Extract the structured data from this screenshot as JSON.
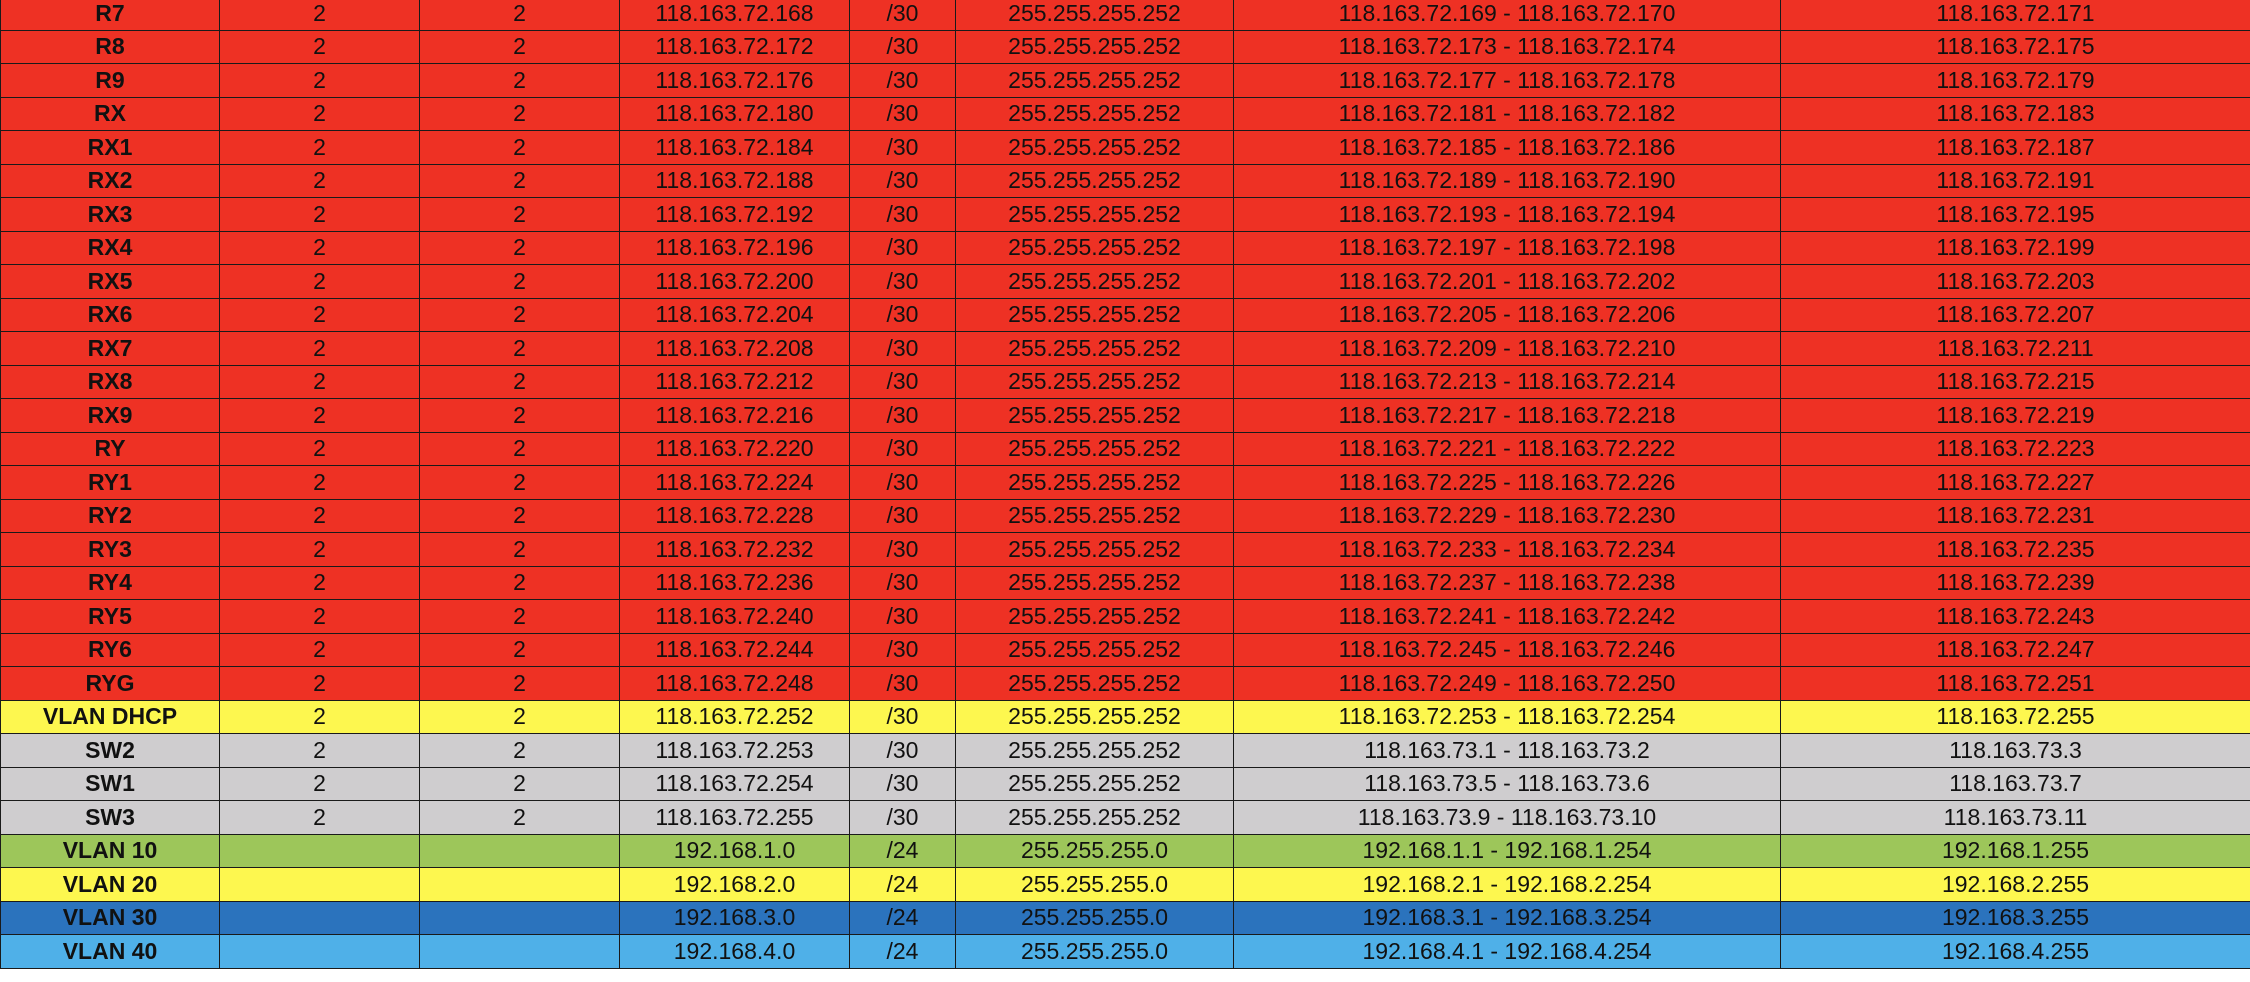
{
  "colors": {
    "red": "#ee3124",
    "yellow": "#fdf74f",
    "gray": "#cfcdcf",
    "green": "#9dc65a",
    "blue": "#2b73bd",
    "lightblue": "#4fb0e8"
  },
  "rows": [
    {
      "name": "R7",
      "a": "2",
      "b": "2",
      "network": "118.163.72.168",
      "cidr": "/30",
      "mask": "255.255.255.252",
      "range": "118.163.72.169 - 118.163.72.170",
      "broadcast": "118.163.72.171",
      "color": "red"
    },
    {
      "name": "R8",
      "a": "2",
      "b": "2",
      "network": "118.163.72.172",
      "cidr": "/30",
      "mask": "255.255.255.252",
      "range": "118.163.72.173 - 118.163.72.174",
      "broadcast": "118.163.72.175",
      "color": "red"
    },
    {
      "name": "R9",
      "a": "2",
      "b": "2",
      "network": "118.163.72.176",
      "cidr": "/30",
      "mask": "255.255.255.252",
      "range": "118.163.72.177 - 118.163.72.178",
      "broadcast": "118.163.72.179",
      "color": "red"
    },
    {
      "name": "RX",
      "a": "2",
      "b": "2",
      "network": "118.163.72.180",
      "cidr": "/30",
      "mask": "255.255.255.252",
      "range": "118.163.72.181 - 118.163.72.182",
      "broadcast": "118.163.72.183",
      "color": "red"
    },
    {
      "name": "RX1",
      "a": "2",
      "b": "2",
      "network": "118.163.72.184",
      "cidr": "/30",
      "mask": "255.255.255.252",
      "range": "118.163.72.185 - 118.163.72.186",
      "broadcast": "118.163.72.187",
      "color": "red"
    },
    {
      "name": "RX2",
      "a": "2",
      "b": "2",
      "network": "118.163.72.188",
      "cidr": "/30",
      "mask": "255.255.255.252",
      "range": "118.163.72.189 - 118.163.72.190",
      "broadcast": "118.163.72.191",
      "color": "red"
    },
    {
      "name": "RX3",
      "a": "2",
      "b": "2",
      "network": "118.163.72.192",
      "cidr": "/30",
      "mask": "255.255.255.252",
      "range": "118.163.72.193 - 118.163.72.194",
      "broadcast": "118.163.72.195",
      "color": "red"
    },
    {
      "name": "RX4",
      "a": "2",
      "b": "2",
      "network": "118.163.72.196",
      "cidr": "/30",
      "mask": "255.255.255.252",
      "range": "118.163.72.197 - 118.163.72.198",
      "broadcast": "118.163.72.199",
      "color": "red"
    },
    {
      "name": "RX5",
      "a": "2",
      "b": "2",
      "network": "118.163.72.200",
      "cidr": "/30",
      "mask": "255.255.255.252",
      "range": "118.163.72.201 - 118.163.72.202",
      "broadcast": "118.163.72.203",
      "color": "red"
    },
    {
      "name": "RX6",
      "a": "2",
      "b": "2",
      "network": "118.163.72.204",
      "cidr": "/30",
      "mask": "255.255.255.252",
      "range": "118.163.72.205 - 118.163.72.206",
      "broadcast": "118.163.72.207",
      "color": "red"
    },
    {
      "name": "RX7",
      "a": "2",
      "b": "2",
      "network": "118.163.72.208",
      "cidr": "/30",
      "mask": "255.255.255.252",
      "range": "118.163.72.209 - 118.163.72.210",
      "broadcast": "118.163.72.211",
      "color": "red"
    },
    {
      "name": "RX8",
      "a": "2",
      "b": "2",
      "network": "118.163.72.212",
      "cidr": "/30",
      "mask": "255.255.255.252",
      "range": "118.163.72.213 - 118.163.72.214",
      "broadcast": "118.163.72.215",
      "color": "red"
    },
    {
      "name": "RX9",
      "a": "2",
      "b": "2",
      "network": "118.163.72.216",
      "cidr": "/30",
      "mask": "255.255.255.252",
      "range": "118.163.72.217 - 118.163.72.218",
      "broadcast": "118.163.72.219",
      "color": "red"
    },
    {
      "name": "RY",
      "a": "2",
      "b": "2",
      "network": "118.163.72.220",
      "cidr": "/30",
      "mask": "255.255.255.252",
      "range": "118.163.72.221 - 118.163.72.222",
      "broadcast": "118.163.72.223",
      "color": "red"
    },
    {
      "name": "RY1",
      "a": "2",
      "b": "2",
      "network": "118.163.72.224",
      "cidr": "/30",
      "mask": "255.255.255.252",
      "range": "118.163.72.225 - 118.163.72.226",
      "broadcast": "118.163.72.227",
      "color": "red"
    },
    {
      "name": "RY2",
      "a": "2",
      "b": "2",
      "network": "118.163.72.228",
      "cidr": "/30",
      "mask": "255.255.255.252",
      "range": "118.163.72.229 - 118.163.72.230",
      "broadcast": "118.163.72.231",
      "color": "red"
    },
    {
      "name": "RY3",
      "a": "2",
      "b": "2",
      "network": "118.163.72.232",
      "cidr": "/30",
      "mask": "255.255.255.252",
      "range": "118.163.72.233 - 118.163.72.234",
      "broadcast": "118.163.72.235",
      "color": "red"
    },
    {
      "name": "RY4",
      "a": "2",
      "b": "2",
      "network": "118.163.72.236",
      "cidr": "/30",
      "mask": "255.255.255.252",
      "range": "118.163.72.237 - 118.163.72.238",
      "broadcast": "118.163.72.239",
      "color": "red"
    },
    {
      "name": "RY5",
      "a": "2",
      "b": "2",
      "network": "118.163.72.240",
      "cidr": "/30",
      "mask": "255.255.255.252",
      "range": "118.163.72.241 - 118.163.72.242",
      "broadcast": "118.163.72.243",
      "color": "red"
    },
    {
      "name": "RY6",
      "a": "2",
      "b": "2",
      "network": "118.163.72.244",
      "cidr": "/30",
      "mask": "255.255.255.252",
      "range": "118.163.72.245 - 118.163.72.246",
      "broadcast": "118.163.72.247",
      "color": "red"
    },
    {
      "name": "RYG",
      "a": "2",
      "b": "2",
      "network": "118.163.72.248",
      "cidr": "/30",
      "mask": "255.255.255.252",
      "range": "118.163.72.249 - 118.163.72.250",
      "broadcast": "118.163.72.251",
      "color": "red"
    },
    {
      "name": "VLAN DHCP",
      "a": "2",
      "b": "2",
      "network": "118.163.72.252",
      "cidr": "/30",
      "mask": "255.255.255.252",
      "range": "118.163.72.253 - 118.163.72.254",
      "broadcast": "118.163.72.255",
      "color": "yellow"
    },
    {
      "name": "SW2",
      "a": "2",
      "b": "2",
      "network": "118.163.72.253",
      "cidr": "/30",
      "mask": "255.255.255.252",
      "range": "118.163.73.1 - 118.163.73.2",
      "broadcast": "118.163.73.3",
      "color": "gray"
    },
    {
      "name": "SW1",
      "a": "2",
      "b": "2",
      "network": "118.163.72.254",
      "cidr": "/30",
      "mask": "255.255.255.252",
      "range": "118.163.73.5 - 118.163.73.6",
      "broadcast": "118.163.73.7",
      "color": "gray"
    },
    {
      "name": "SW3",
      "a": "2",
      "b": "2",
      "network": "118.163.72.255",
      "cidr": "/30",
      "mask": "255.255.255.252",
      "range": "118.163.73.9 - 118.163.73.10",
      "broadcast": "118.163.73.11",
      "color": "gray"
    },
    {
      "name": "VLAN 10",
      "a": "",
      "b": "",
      "network": "192.168.1.0",
      "cidr": "/24",
      "mask": "255.255.255.0",
      "range": "192.168.1.1 - 192.168.1.254",
      "broadcast": "192.168.1.255",
      "color": "green"
    },
    {
      "name": "VLAN 20",
      "a": "",
      "b": "",
      "network": "192.168.2.0",
      "cidr": "/24",
      "mask": "255.255.255.0",
      "range": "192.168.2.1 - 192.168.2.254",
      "broadcast": "192.168.2.255",
      "color": "yellow"
    },
    {
      "name": "VLAN 30",
      "a": "",
      "b": "",
      "network": "192.168.3.0",
      "cidr": "/24",
      "mask": "255.255.255.0",
      "range": "192.168.3.1 - 192.168.3.254",
      "broadcast": "192.168.3.255",
      "color": "blue"
    },
    {
      "name": "VLAN 40",
      "a": "",
      "b": "",
      "network": "192.168.4.0",
      "cidr": "/24",
      "mask": "255.255.255.0",
      "range": "192.168.4.1 - 192.168.4.254",
      "broadcast": "192.168.4.255",
      "color": "lightblue"
    }
  ]
}
